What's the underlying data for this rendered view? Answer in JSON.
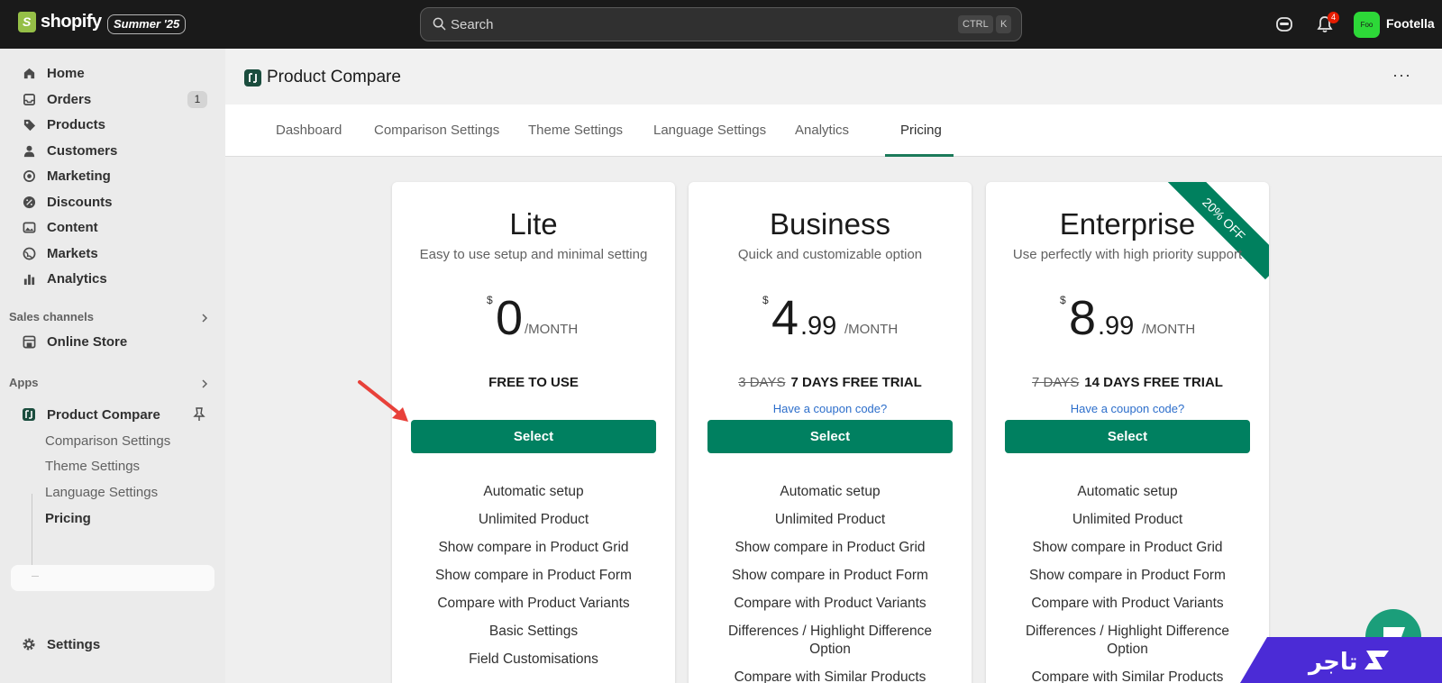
{
  "topbar": {
    "brand": "shopify",
    "edition": "Summer '25",
    "search_placeholder": "Search",
    "kbd_ctrl": "CTRL",
    "kbd_k": "K",
    "notification_count": "4",
    "store_avatar": "Foo",
    "store_name": "Footella"
  },
  "sidebar": {
    "items": [
      {
        "label": "Home",
        "icon": "home-icon"
      },
      {
        "label": "Orders",
        "icon": "inbox-icon",
        "count": "1"
      },
      {
        "label": "Products",
        "icon": "tag-icon"
      },
      {
        "label": "Customers",
        "icon": "person-icon"
      },
      {
        "label": "Marketing",
        "icon": "target-icon"
      },
      {
        "label": "Discounts",
        "icon": "discount-icon"
      },
      {
        "label": "Content",
        "icon": "image-icon"
      },
      {
        "label": "Markets",
        "icon": "globe-icon"
      },
      {
        "label": "Analytics",
        "icon": "bar-chart-icon"
      }
    ],
    "sales_channels_label": "Sales channels",
    "online_store": "Online Store",
    "apps_label": "Apps",
    "app_name": "Product Compare",
    "app_subitems": [
      "Comparison Settings",
      "Theme Settings",
      "Language Settings",
      "Pricing"
    ],
    "settings": "Settings"
  },
  "app": {
    "title": "Product Compare",
    "more": "···",
    "tabs": [
      "Dashboard",
      "Comparison Settings",
      "Theme Settings",
      "Language Settings",
      "Analytics",
      "Pricing"
    ],
    "active_tab": "Pricing"
  },
  "plans": [
    {
      "name": "Lite",
      "desc": "Easy to use setup and minimal setting",
      "currency": "$",
      "price_int": "0",
      "price_dec": "",
      "per": "/MONTH",
      "trial_old": "",
      "trial": "FREE TO USE",
      "coupon": "",
      "button": "Select",
      "features": [
        "Automatic setup",
        "Unlimited Product",
        "Show compare in Product Grid",
        "Show compare in Product Form",
        "Compare with Product Variants",
        "Basic Settings",
        "Field Customisations"
      ]
    },
    {
      "name": "Business",
      "desc": "Quick and customizable option",
      "currency": "$",
      "price_int": "4",
      "price_dec": ".99",
      "per": "/MONTH",
      "trial_old": "3 DAYS",
      "trial": "7 DAYS FREE TRIAL",
      "coupon": "Have a coupon code?",
      "button": "Select",
      "features": [
        "Automatic setup",
        "Unlimited Product",
        "Show compare in Product Grid",
        "Show compare in Product Form",
        "Compare with Product Variants",
        "Differences / Highlight Difference Option",
        "Compare with Similar Products"
      ]
    },
    {
      "name": "Enterprise",
      "desc": "Use perfectly with high priority support",
      "currency": "$",
      "price_int": "8",
      "price_dec": ".99",
      "per": "/MONTH",
      "trial_old": "7 DAYS",
      "trial": "14 DAYS FREE TRIAL",
      "coupon": "Have a coupon code?",
      "button": "Select",
      "ribbon": "20% OFF",
      "features": [
        "Automatic setup",
        "Unlimited Product",
        "Show compare in Product Grid",
        "Show compare in Product Form",
        "Compare with Product Variants",
        "Differences / Highlight Difference Option",
        "Compare with Similar Products"
      ]
    }
  ],
  "colors": {
    "topbar": "#1a1a1a",
    "accent_green": "#008060",
    "link_blue": "#2c6ecb",
    "arrow_red": "#e8413a",
    "badge_purple": "#4b2bd6"
  },
  "watermark": "تاجر"
}
